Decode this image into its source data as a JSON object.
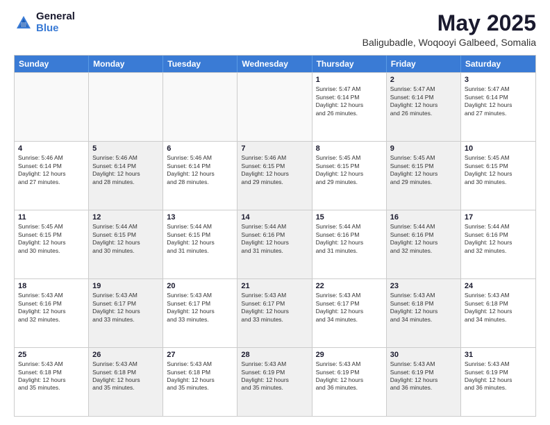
{
  "logo": {
    "general": "General",
    "blue": "Blue"
  },
  "title": "May 2025",
  "subtitle": "Baligubadle, Woqooyi Galbeed, Somalia",
  "header_days": [
    "Sunday",
    "Monday",
    "Tuesday",
    "Wednesday",
    "Thursday",
    "Friday",
    "Saturday"
  ],
  "rows": [
    [
      {
        "day": "",
        "empty": true
      },
      {
        "day": "",
        "empty": true
      },
      {
        "day": "",
        "empty": true
      },
      {
        "day": "",
        "empty": true
      },
      {
        "day": "1",
        "info": "Sunrise: 5:47 AM\nSunset: 6:14 PM\nDaylight: 12 hours\nand 26 minutes."
      },
      {
        "day": "2",
        "info": "Sunrise: 5:47 AM\nSunset: 6:14 PM\nDaylight: 12 hours\nand 26 minutes.",
        "shaded": true
      },
      {
        "day": "3",
        "info": "Sunrise: 5:47 AM\nSunset: 6:14 PM\nDaylight: 12 hours\nand 27 minutes."
      }
    ],
    [
      {
        "day": "4",
        "info": "Sunrise: 5:46 AM\nSunset: 6:14 PM\nDaylight: 12 hours\nand 27 minutes."
      },
      {
        "day": "5",
        "info": "Sunrise: 5:46 AM\nSunset: 6:14 PM\nDaylight: 12 hours\nand 28 minutes.",
        "shaded": true
      },
      {
        "day": "6",
        "info": "Sunrise: 5:46 AM\nSunset: 6:14 PM\nDaylight: 12 hours\nand 28 minutes."
      },
      {
        "day": "7",
        "info": "Sunrise: 5:46 AM\nSunset: 6:15 PM\nDaylight: 12 hours\nand 29 minutes.",
        "shaded": true
      },
      {
        "day": "8",
        "info": "Sunrise: 5:45 AM\nSunset: 6:15 PM\nDaylight: 12 hours\nand 29 minutes."
      },
      {
        "day": "9",
        "info": "Sunrise: 5:45 AM\nSunset: 6:15 PM\nDaylight: 12 hours\nand 29 minutes.",
        "shaded": true
      },
      {
        "day": "10",
        "info": "Sunrise: 5:45 AM\nSunset: 6:15 PM\nDaylight: 12 hours\nand 30 minutes."
      }
    ],
    [
      {
        "day": "11",
        "info": "Sunrise: 5:45 AM\nSunset: 6:15 PM\nDaylight: 12 hours\nand 30 minutes."
      },
      {
        "day": "12",
        "info": "Sunrise: 5:44 AM\nSunset: 6:15 PM\nDaylight: 12 hours\nand 30 minutes.",
        "shaded": true
      },
      {
        "day": "13",
        "info": "Sunrise: 5:44 AM\nSunset: 6:15 PM\nDaylight: 12 hours\nand 31 minutes."
      },
      {
        "day": "14",
        "info": "Sunrise: 5:44 AM\nSunset: 6:16 PM\nDaylight: 12 hours\nand 31 minutes.",
        "shaded": true
      },
      {
        "day": "15",
        "info": "Sunrise: 5:44 AM\nSunset: 6:16 PM\nDaylight: 12 hours\nand 31 minutes."
      },
      {
        "day": "16",
        "info": "Sunrise: 5:44 AM\nSunset: 6:16 PM\nDaylight: 12 hours\nand 32 minutes.",
        "shaded": true
      },
      {
        "day": "17",
        "info": "Sunrise: 5:44 AM\nSunset: 6:16 PM\nDaylight: 12 hours\nand 32 minutes."
      }
    ],
    [
      {
        "day": "18",
        "info": "Sunrise: 5:43 AM\nSunset: 6:16 PM\nDaylight: 12 hours\nand 32 minutes."
      },
      {
        "day": "19",
        "info": "Sunrise: 5:43 AM\nSunset: 6:17 PM\nDaylight: 12 hours\nand 33 minutes.",
        "shaded": true
      },
      {
        "day": "20",
        "info": "Sunrise: 5:43 AM\nSunset: 6:17 PM\nDaylight: 12 hours\nand 33 minutes."
      },
      {
        "day": "21",
        "info": "Sunrise: 5:43 AM\nSunset: 6:17 PM\nDaylight: 12 hours\nand 33 minutes.",
        "shaded": true
      },
      {
        "day": "22",
        "info": "Sunrise: 5:43 AM\nSunset: 6:17 PM\nDaylight: 12 hours\nand 34 minutes."
      },
      {
        "day": "23",
        "info": "Sunrise: 5:43 AM\nSunset: 6:18 PM\nDaylight: 12 hours\nand 34 minutes.",
        "shaded": true
      },
      {
        "day": "24",
        "info": "Sunrise: 5:43 AM\nSunset: 6:18 PM\nDaylight: 12 hours\nand 34 minutes."
      }
    ],
    [
      {
        "day": "25",
        "info": "Sunrise: 5:43 AM\nSunset: 6:18 PM\nDaylight: 12 hours\nand 35 minutes."
      },
      {
        "day": "26",
        "info": "Sunrise: 5:43 AM\nSunset: 6:18 PM\nDaylight: 12 hours\nand 35 minutes.",
        "shaded": true
      },
      {
        "day": "27",
        "info": "Sunrise: 5:43 AM\nSunset: 6:18 PM\nDaylight: 12 hours\nand 35 minutes."
      },
      {
        "day": "28",
        "info": "Sunrise: 5:43 AM\nSunset: 6:19 PM\nDaylight: 12 hours\nand 35 minutes.",
        "shaded": true
      },
      {
        "day": "29",
        "info": "Sunrise: 5:43 AM\nSunset: 6:19 PM\nDaylight: 12 hours\nand 36 minutes."
      },
      {
        "day": "30",
        "info": "Sunrise: 5:43 AM\nSunset: 6:19 PM\nDaylight: 12 hours\nand 36 minutes.",
        "shaded": true
      },
      {
        "day": "31",
        "info": "Sunrise: 5:43 AM\nSunset: 6:19 PM\nDaylight: 12 hours\nand 36 minutes."
      }
    ]
  ]
}
